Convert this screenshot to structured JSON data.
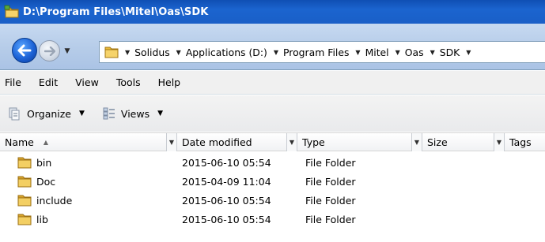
{
  "window": {
    "title": "D:\\Program Files\\Mitel\\Oas\\SDK"
  },
  "address": {
    "crumbs": [
      "Solidus",
      "Applications (D:)",
      "Program Files",
      "Mitel",
      "Oas",
      "SDK"
    ]
  },
  "menu": {
    "items": [
      "File",
      "Edit",
      "View",
      "Tools",
      "Help"
    ]
  },
  "commands": {
    "organize": "Organize",
    "views": "Views"
  },
  "columns": {
    "name": "Name",
    "date": "Date modified",
    "type": "Type",
    "size": "Size",
    "tags": "Tags"
  },
  "files": [
    {
      "name": "bin",
      "date": "2015-06-10 05:54",
      "type": "File Folder"
    },
    {
      "name": "Doc",
      "date": "2015-04-09 11:04",
      "type": "File Folder"
    },
    {
      "name": "include",
      "date": "2015-06-10 05:54",
      "type": "File Folder"
    },
    {
      "name": "lib",
      "date": "2015-06-10 05:54",
      "type": "File Folder"
    }
  ],
  "colors": {
    "titlebar": "#1a5fc7",
    "navbar": "#b7cde9",
    "folder": "#e8b93a"
  },
  "icons": {
    "title": "folder-icon",
    "back": "back-arrow-icon",
    "forward": "forward-arrow-icon",
    "organize": "organize-icon",
    "views": "views-icon"
  }
}
